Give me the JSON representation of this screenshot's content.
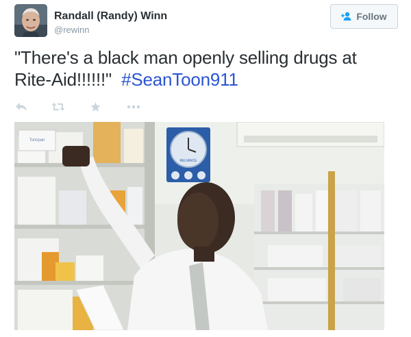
{
  "author": {
    "name": "Randall (Randy) Winn",
    "handle": "@rewinn"
  },
  "follow_button": {
    "label": "Follow"
  },
  "tweet": {
    "text": "\"There's a black man openly selling drugs at Rite-Aid!!!!!!\"",
    "hashtag": "#SeanToon911"
  },
  "actions": [
    "reply-icon",
    "retweet-icon",
    "favorite-icon",
    "more-icon"
  ],
  "media": {
    "box_label": "Tonopan",
    "clock_label": "RELIANCE"
  },
  "colors": {
    "hashtag": "#2b55d2",
    "icon_gray": "#ccd6dd",
    "follow_text": "#66757f"
  }
}
